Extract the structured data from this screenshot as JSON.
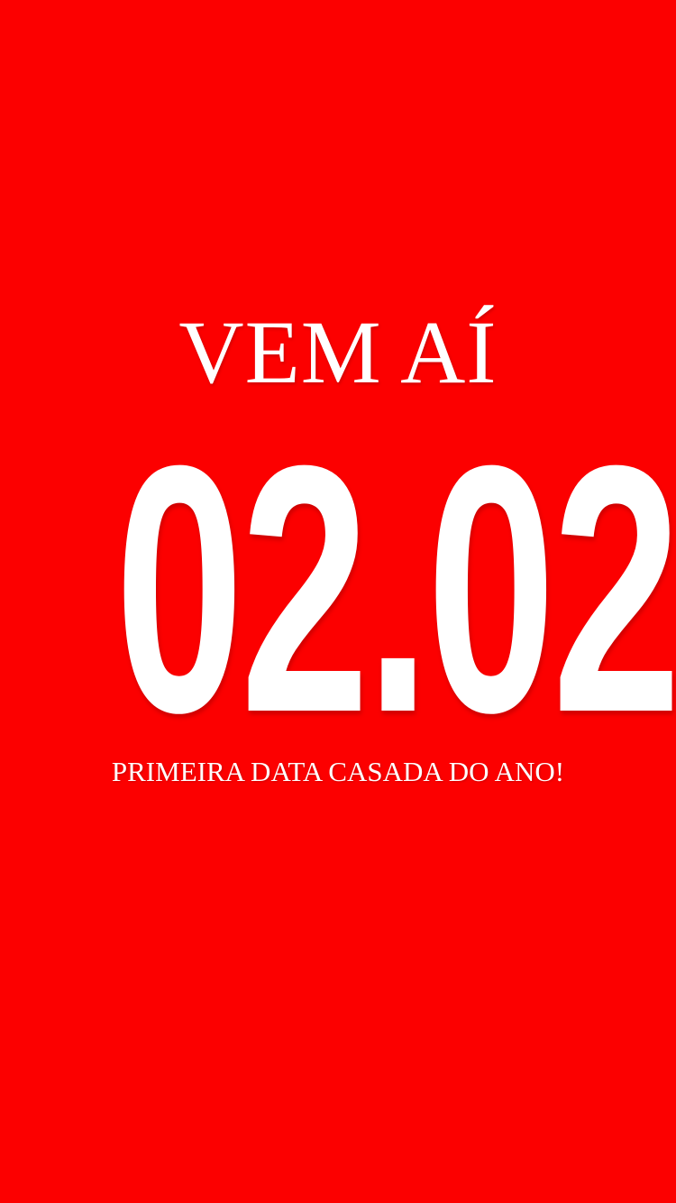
{
  "story": {
    "headline": "VEM AÍ",
    "date": "02.02",
    "subline": "PRIMEIRA DATA CASADA DO ANO!"
  },
  "colors": {
    "background": "#fc0000",
    "text": "#ffffff"
  }
}
